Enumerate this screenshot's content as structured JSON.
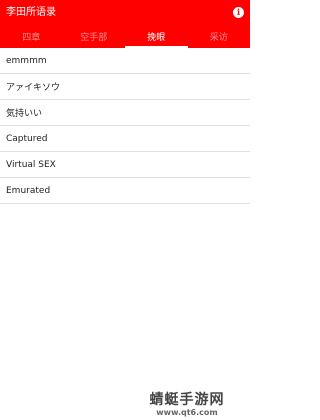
{
  "appbar": {
    "title": "李田所语录",
    "info_icon": "info-icon"
  },
  "tabs": [
    {
      "label": "四章",
      "active": false
    },
    {
      "label": "空手部",
      "active": false
    },
    {
      "label": "挽眼",
      "active": true
    },
    {
      "label": "采访",
      "active": false
    }
  ],
  "list": {
    "items": [
      {
        "label": "emmmm"
      },
      {
        "label": "アァイキソウ"
      },
      {
        "label": "気持いい"
      },
      {
        "label": "Captured"
      },
      {
        "label": "Virtual SEX"
      },
      {
        "label": "Emurated"
      }
    ]
  },
  "watermark": {
    "main": "蜻蜓手游网",
    "sub": "www.qt6.com"
  },
  "colors": {
    "accent": "#ff0000",
    "tab_inactive": "#ffb3b3",
    "divider": "#e0e0e0"
  }
}
